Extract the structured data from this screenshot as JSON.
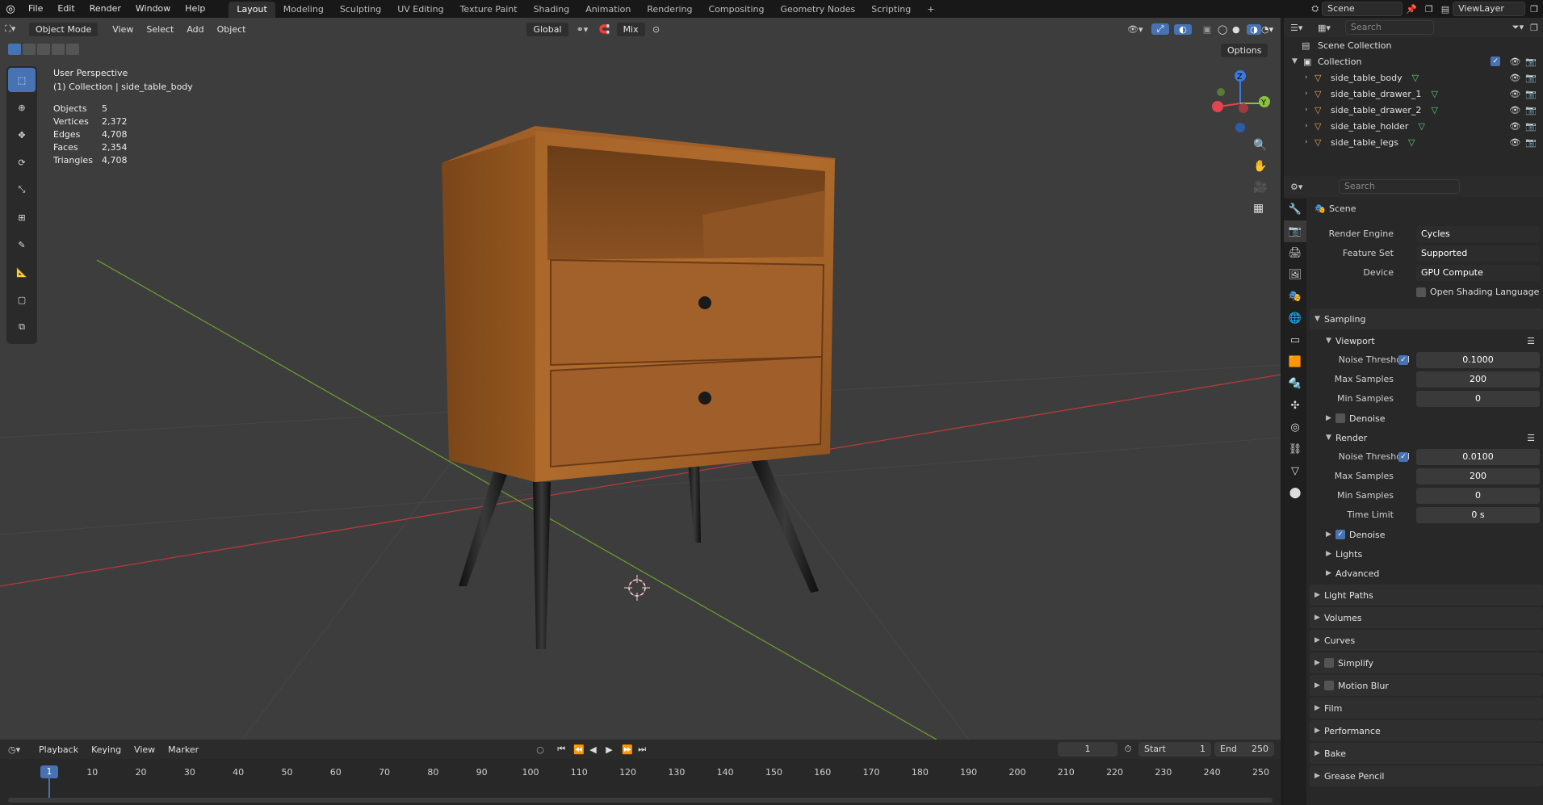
{
  "topbar": {
    "menus": [
      "File",
      "Edit",
      "Render",
      "Window",
      "Help"
    ],
    "workspaces": [
      "Layout",
      "Modeling",
      "Sculpting",
      "UV Editing",
      "Texture Paint",
      "Shading",
      "Animation",
      "Rendering",
      "Compositing",
      "Geometry Nodes",
      "Scripting"
    ],
    "active_workspace": "Layout",
    "scene": "Scene",
    "view_layer": "ViewLayer"
  },
  "viewport": {
    "mode": "Object Mode",
    "menus": [
      "View",
      "Select",
      "Add",
      "Object"
    ],
    "orientation": "Global",
    "snap": "Mix",
    "options": "Options",
    "perspective": "User Perspective",
    "active": "(1) Collection | side_table_body",
    "stats": [
      {
        "label": "Objects",
        "value": "5"
      },
      {
        "label": "Vertices",
        "value": "2,372"
      },
      {
        "label": "Edges",
        "value": "4,708"
      },
      {
        "label": "Faces",
        "value": "2,354"
      },
      {
        "label": "Triangles",
        "value": "4,708"
      }
    ],
    "gizmo": {
      "x": "X",
      "y": "Y",
      "z": "Z"
    }
  },
  "timeline": {
    "menus": [
      "Playback",
      "Keying",
      "View",
      "Marker"
    ],
    "current_frame": "1",
    "start_label": "Start",
    "start": "1",
    "end_label": "End",
    "end": "250",
    "ruler": [
      "1",
      "10",
      "20",
      "30",
      "40",
      "50",
      "60",
      "70",
      "80",
      "90",
      "100",
      "110",
      "120",
      "130",
      "140",
      "150",
      "160",
      "170",
      "180",
      "190",
      "200",
      "210",
      "220",
      "230",
      "240",
      "250"
    ]
  },
  "outliner": {
    "search_placeholder": "Search",
    "root": "Scene Collection",
    "collection": "Collection",
    "objects": [
      "side_table_body",
      "side_table_drawer_1",
      "side_table_drawer_2",
      "side_table_holder",
      "side_table_legs"
    ]
  },
  "properties": {
    "search_placeholder": "Search",
    "context": "Scene",
    "render_engine_label": "Render Engine",
    "render_engine": "Cycles",
    "feature_set_label": "Feature Set",
    "feature_set": "Supported",
    "device_label": "Device",
    "device": "GPU Compute",
    "osl_label": "Open Shading Language",
    "sampling": "Sampling",
    "viewport_label": "Viewport",
    "noise_threshold_label": "Noise Threshold",
    "vp_noise": "0.1000",
    "max_samples_label": "Max Samples",
    "vp_max": "200",
    "min_samples_label": "Min Samples",
    "vp_min": "0",
    "denoise_label": "Denoise",
    "render_label": "Render",
    "r_noise": "0.0100",
    "r_max": "200",
    "r_min": "0",
    "time_limit_label": "Time Limit",
    "r_time": "0 s",
    "lights": "Lights",
    "advanced": "Advanced",
    "panels": [
      "Light Paths",
      "Volumes",
      "Curves",
      "Simplify",
      "Motion Blur",
      "Film",
      "Performance",
      "Bake",
      "Grease Pencil"
    ]
  },
  "colors": {
    "accent": "#4772b3",
    "x_axis": "#e5434f",
    "y_axis": "#8bc140",
    "z_axis": "#3c7ae0",
    "wood": "#9a5a22"
  }
}
